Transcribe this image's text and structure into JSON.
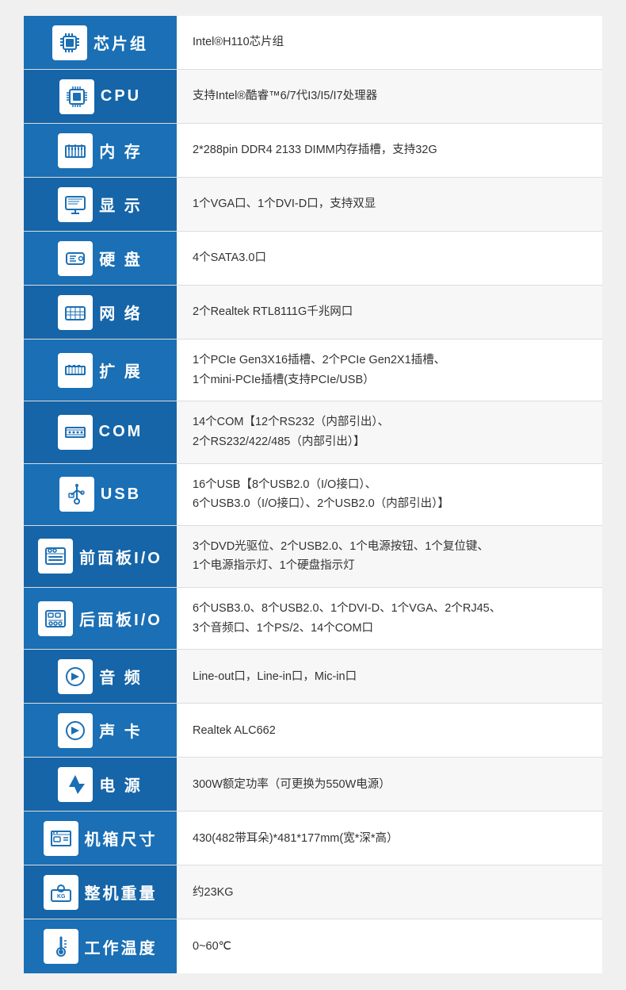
{
  "rows": [
    {
      "id": "chipset",
      "label": "芯片组",
      "icon": "chipset",
      "value": "Intel®H110芯片组"
    },
    {
      "id": "cpu",
      "label": "CPU",
      "icon": "cpu",
      "value": "支持Intel®酷睿™6/7代I3/I5/I7处理器"
    },
    {
      "id": "memory",
      "label": "内  存",
      "icon": "memory",
      "value": "2*288pin DDR4 2133 DIMM内存插槽，支持32G"
    },
    {
      "id": "display",
      "label": "显  示",
      "icon": "display",
      "value": "1个VGA口、1个DVI-D口，支持双显"
    },
    {
      "id": "hdd",
      "label": "硬  盘",
      "icon": "hdd",
      "value": "4个SATA3.0口"
    },
    {
      "id": "network",
      "label": "网  络",
      "icon": "network",
      "value": "2个Realtek RTL8111G千兆网口"
    },
    {
      "id": "expansion",
      "label": "扩  展",
      "icon": "expansion",
      "value": "1个PCIe Gen3X16插槽、2个PCIe Gen2X1插槽、\n1个mini-PCIe插槽(支持PCIe/USB）"
    },
    {
      "id": "com",
      "label": "COM",
      "icon": "com",
      "value": "14个COM【12个RS232（内部引出）、\n2个RS232/422/485（内部引出）】"
    },
    {
      "id": "usb",
      "label": "USB",
      "icon": "usb",
      "value": "16个USB【8个USB2.0（I/O接口）、\n6个USB3.0（I/O接口）、2个USB2.0（内部引出）】"
    },
    {
      "id": "front-io",
      "label": "前面板I/O",
      "icon": "front-io",
      "value": "3个DVD光驱位、2个USB2.0、1个电源按钮、1个复位键、\n1个电源指示灯、1个硬盘指示灯"
    },
    {
      "id": "rear-io",
      "label": "后面板I/O",
      "icon": "rear-io",
      "value": "6个USB3.0、8个USB2.0、1个DVI-D、1个VGA、2个RJ45、\n3个音频口、1个PS/2、14个COM口"
    },
    {
      "id": "audio",
      "label": "音  频",
      "icon": "audio",
      "value": "Line-out口，Line-in口，Mic-in口"
    },
    {
      "id": "sound-card",
      "label": "声  卡",
      "icon": "sound-card",
      "value": "Realtek ALC662"
    },
    {
      "id": "power",
      "label": "电  源",
      "icon": "power",
      "value": "300W额定功率（可更换为550W电源）"
    },
    {
      "id": "chassis",
      "label": "机箱尺寸",
      "icon": "chassis",
      "value": "430(482带耳朵)*481*177mm(宽*深*高）"
    },
    {
      "id": "weight",
      "label": "整机重量",
      "icon": "weight",
      "value": "约23KG"
    },
    {
      "id": "temperature",
      "label": "工作温度",
      "icon": "temperature",
      "value": "0~60℃"
    }
  ]
}
